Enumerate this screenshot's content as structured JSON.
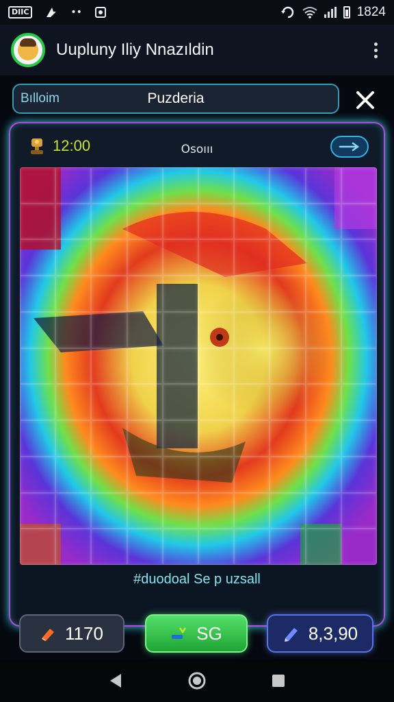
{
  "status_bar": {
    "sim_label": "DIIC",
    "time": "1824",
    "icons": [
      "sim-icon",
      "notification-icon",
      "dot-icon",
      "screenshot-icon",
      "sync-icon",
      "wifi-icon",
      "signal-icon",
      "battery-icon"
    ]
  },
  "header": {
    "title": "Uupluny Iliy Nnazıldin",
    "avatar": "avatar-icon",
    "menu_icon": "more-vertical-icon"
  },
  "search": {
    "label": "Bılloim",
    "title": "Puzderia",
    "close_icon": "close-icon"
  },
  "game": {
    "timer_icon": "trophy-icon",
    "timer": "12:00",
    "level_label": "Osoııı",
    "next_icon": "arrow-right-icon",
    "grid_columns": 10,
    "grid_rows": 11,
    "caption": "#duodoal Se p uzsall"
  },
  "actions": {
    "hint_icon": "eraser-icon",
    "hint_value": "1170",
    "go_icon": "wand-icon",
    "go_label": "SG",
    "coins_icon": "pencil-icon",
    "coins_value": "8,3,90"
  },
  "colors": {
    "accent_cyan": "#3ec9e0",
    "accent_purple": "#b04de0",
    "timer_green": "#c7e534",
    "go_green": "#2cc84a",
    "coin_blue": "#5a72e8"
  },
  "nav": {
    "back_icon": "back-triangle-icon",
    "home_icon": "home-circle-icon",
    "recents_icon": "recents-square-icon"
  }
}
